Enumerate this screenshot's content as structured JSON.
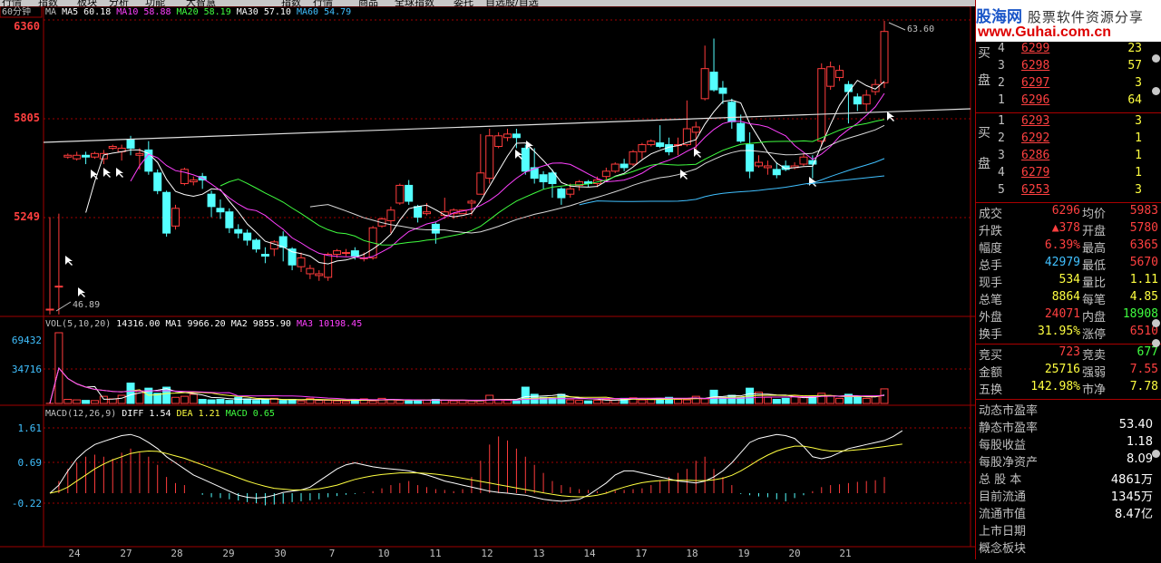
{
  "menubar": {
    "items": [
      "行情",
      "指数",
      "板块",
      "分析",
      "功能",
      "大智慧",
      "指数",
      "行情",
      "商品",
      "全球指数",
      "委托",
      "自选股/自选"
    ]
  },
  "chart_header": {
    "period": "60分钟",
    "ma_label": "MA",
    "ma": [
      {
        "name": "MA5",
        "value": "60.18",
        "color": "#ffffff"
      },
      {
        "name": "MA10",
        "value": "58.88",
        "color": "#ff40ff"
      },
      {
        "name": "MA20",
        "value": "58.19",
        "color": "#40ff40"
      },
      {
        "name": "MA30",
        "value": "57.10",
        "color": "#ffffff"
      },
      {
        "name": "MA60",
        "value": "54.79",
        "color": "#40c0ff"
      }
    ]
  },
  "price_axis": {
    "labels": [
      "6360",
      "5805",
      "5249"
    ],
    "high_mark": "63.60",
    "low_mark": "46.89"
  },
  "vol_header": {
    "label": "VOL(5,10,20)",
    "vol": "14316.00",
    "ma1": "MA1 9966.20",
    "ma2": "MA2 9855.90",
    "ma3": "MA3 10198.45"
  },
  "vol_axis": {
    "labels": [
      "69432",
      "34716"
    ]
  },
  "macd_header": {
    "label": "MACD(12,26,9)",
    "diff": "DIFF 1.54",
    "dea": "DEA 1.21",
    "macd": "MACD 0.65"
  },
  "macd_axis": {
    "labels": [
      "1.61",
      "0.69",
      "-0.22"
    ]
  },
  "date_axis": {
    "labels": [
      "24",
      "27",
      "28",
      "29",
      "30",
      "7",
      "10",
      "11",
      "12",
      "13",
      "14",
      "17",
      "18",
      "19",
      "20",
      "21"
    ]
  },
  "chart_data": {
    "type": "candlestick",
    "price_range": [
      46.89,
      63.6
    ],
    "vol_range": [
      0,
      69432
    ],
    "macd_range": [
      -0.22,
      1.61
    ],
    "candles": [
      [
        47.3,
        47.3,
        52.5,
        47.0,
        60
      ],
      [
        48.6,
        48.6,
        52.7,
        47.0,
        69432
      ],
      [
        55.9,
        56.0,
        56.1,
        55.8,
        4000
      ],
      [
        55.8,
        56.0,
        56.2,
        55.7,
        3500
      ],
      [
        56.0,
        55.9,
        56.2,
        55.5,
        3000
      ],
      [
        55.9,
        56.1,
        56.2,
        55.8,
        2800
      ],
      [
        55.8,
        56.1,
        56.3,
        55.5,
        7000
      ],
      [
        56.4,
        56.5,
        56.6,
        56.3,
        4500
      ],
      [
        56.2,
        56.4,
        56.6,
        55.7,
        8000
      ],
      [
        56.9,
        56.4,
        57.1,
        56.0,
        20000
      ],
      [
        56.0,
        56.1,
        56.4,
        55.2,
        12000
      ],
      [
        56.3,
        55.1,
        56.8,
        54.9,
        15000
      ],
      [
        55.0,
        54.0,
        55.2,
        53.8,
        10000
      ],
      [
        53.9,
        51.6,
        54.0,
        51.4,
        16000
      ],
      [
        52.0,
        53.0,
        53.2,
        51.8,
        6000
      ],
      [
        54.4,
        55.2,
        55.3,
        54.3,
        7000
      ],
      [
        54.5,
        54.6,
        54.8,
        54.3,
        9000
      ],
      [
        54.8,
        54.6,
        55.0,
        54.1,
        4000
      ],
      [
        53.8,
        53.1,
        54.0,
        52.5,
        3500
      ],
      [
        53.0,
        52.8,
        53.5,
        52.4,
        4000
      ],
      [
        52.8,
        51.9,
        53.0,
        51.6,
        3000
      ],
      [
        51.8,
        51.6,
        52.1,
        51.3,
        6000
      ],
      [
        51.6,
        51.2,
        51.8,
        50.9,
        4500
      ],
      [
        51.2,
        50.7,
        51.3,
        50.5,
        3000
      ],
      [
        50.4,
        50.3,
        50.8,
        49.9,
        3500
      ],
      [
        50.7,
        51.1,
        51.2,
        50.3,
        5000
      ],
      [
        51.4,
        50.8,
        51.7,
        50.0,
        3000
      ],
      [
        50.7,
        49.8,
        50.8,
        49.5,
        4000
      ],
      [
        49.7,
        50.2,
        50.5,
        49.4,
        2500
      ],
      [
        49.3,
        49.6,
        49.8,
        49.0,
        5000
      ],
      [
        49.2,
        49.3,
        49.5,
        48.9,
        3000
      ],
      [
        49.1,
        50.4,
        50.5,
        48.9,
        3000
      ],
      [
        50.4,
        50.6,
        50.7,
        50.2,
        2500
      ],
      [
        50.5,
        50.5,
        50.7,
        50.3,
        2000
      ],
      [
        50.6,
        50.3,
        50.8,
        50.1,
        4000
      ],
      [
        50.2,
        50.2,
        50.5,
        50.0,
        4500
      ],
      [
        50.2,
        51.9,
        52.0,
        50.1,
        2500
      ],
      [
        52.0,
        52.4,
        52.5,
        51.9,
        5000
      ],
      [
        52.3,
        52.9,
        53.1,
        51.6,
        4000
      ],
      [
        53.3,
        54.3,
        54.4,
        53.2,
        3000
      ],
      [
        54.3,
        53.4,
        54.6,
        53.2,
        2500
      ],
      [
        53.1,
        52.5,
        53.2,
        52.2,
        2800
      ],
      [
        52.7,
        52.8,
        53.3,
        52.6,
        3200
      ],
      [
        52.1,
        51.6,
        52.2,
        51.0,
        4000
      ],
      [
        52.6,
        52.8,
        53.6,
        52.4,
        3000
      ],
      [
        52.7,
        52.9,
        53.0,
        52.4,
        2500
      ],
      [
        52.7,
        52.9,
        52.9,
        52.7,
        2800
      ],
      [
        53.3,
        53.4,
        53.5,
        52.6,
        2500
      ],
      [
        53.8,
        55.0,
        57.2,
        53.8,
        2500
      ],
      [
        54.7,
        57.1,
        57.5,
        54.4,
        8000
      ],
      [
        56.5,
        57.1,
        57.3,
        56.4,
        4000
      ],
      [
        57.0,
        57.2,
        57.5,
        56.8,
        3000
      ],
      [
        57.2,
        57.0,
        57.5,
        56.4,
        2500
      ],
      [
        56.4,
        55.1,
        56.6,
        54.9,
        16000
      ],
      [
        55.3,
        54.7,
        56.4,
        54.4,
        9000
      ],
      [
        54.9,
        54.5,
        55.1,
        54.1,
        6000
      ],
      [
        55.0,
        54.4,
        55.2,
        53.6,
        5000
      ],
      [
        54.1,
        53.6,
        54.2,
        53.2,
        9000
      ],
      [
        53.8,
        54.1,
        54.4,
        53.6,
        3500
      ],
      [
        54.3,
        54.5,
        54.6,
        54.0,
        3000
      ],
      [
        54.5,
        54.4,
        54.6,
        54.2,
        2500
      ],
      [
        54.4,
        54.6,
        54.8,
        54.2,
        3000
      ],
      [
        54.8,
        55.1,
        55.3,
        54.6,
        4000
      ],
      [
        55.1,
        55.5,
        55.6,
        55.0,
        3500
      ],
      [
        55.5,
        55.3,
        55.8,
        55.1,
        5000
      ],
      [
        55.5,
        56.2,
        56.3,
        55.4,
        5500
      ],
      [
        56.2,
        56.6,
        56.7,
        55.8,
        3500
      ],
      [
        56.6,
        56.8,
        56.9,
        56.5,
        4500
      ],
      [
        56.7,
        56.5,
        57.7,
        56.4,
        5000
      ],
      [
        56.6,
        56.2,
        57.0,
        56.0,
        6000
      ],
      [
        56.6,
        56.6,
        57.0,
        56.0,
        4000
      ],
      [
        56.6,
        57.5,
        59.1,
        56.5,
        3500
      ],
      [
        57.3,
        57.6,
        57.9,
        56.2,
        7000
      ],
      [
        59.2,
        60.9,
        62.2,
        59.1,
        4500
      ],
      [
        60.7,
        59.7,
        62.6,
        59.6,
        13000
      ],
      [
        59.8,
        59.5,
        60.2,
        58.9,
        6000
      ],
      [
        59.0,
        57.9,
        59.2,
        57.5,
        8000
      ],
      [
        57.8,
        56.8,
        58.3,
        56.7,
        6000
      ],
      [
        56.6,
        55.1,
        57.3,
        54.7,
        15000
      ],
      [
        55.4,
        55.6,
        56.0,
        55.3,
        11000
      ],
      [
        55.3,
        55.4,
        55.7,
        54.9,
        6000
      ],
      [
        55.2,
        54.9,
        55.6,
        54.7,
        4000
      ],
      [
        55.4,
        55.2,
        55.7,
        55.1,
        5000
      ],
      [
        55.3,
        55.4,
        55.6,
        55.2,
        7000
      ],
      [
        55.5,
        55.9,
        56.1,
        55.4,
        6500
      ],
      [
        55.7,
        55.5,
        56.0,
        54.7,
        7000
      ],
      [
        56.8,
        60.9,
        61.2,
        56.5,
        10000
      ],
      [
        59.9,
        61.0,
        61.3,
        59.7,
        7500
      ],
      [
        60.4,
        60.8,
        61.1,
        60.2,
        5000
      ],
      [
        60.0,
        59.6,
        60.2,
        57.8,
        9000
      ],
      [
        59.3,
        58.9,
        59.5,
        58.5,
        6500
      ],
      [
        58.9,
        59.4,
        59.7,
        58.5,
        5000
      ],
      [
        59.6,
        60.0,
        60.3,
        59.4,
        7000
      ],
      [
        60.1,
        63.0,
        63.6,
        59.8,
        14316
      ]
    ],
    "macd_hist": [
      0.0,
      0.3,
      0.6,
      0.75,
      0.9,
      0.95,
      0.9,
      0.85,
      1.0,
      1.1,
      1.0,
      0.9,
      0.7,
      0.4,
      0.25,
      0.2,
      0.0,
      -0.04,
      -0.1,
      -0.12,
      -0.15,
      -0.18,
      -0.22,
      -0.25,
      -0.3,
      -0.28,
      -0.26,
      -0.22,
      -0.2,
      -0.18,
      -0.15,
      -0.1,
      -0.07,
      -0.04,
      -0.02,
      0.02,
      0.05,
      0.12,
      0.2,
      0.25,
      0.3,
      0.2,
      0.15,
      0.1,
      0.08,
      0.05,
      0.1,
      0.4,
      0.8,
      1.2,
      1.4,
      1.3,
      1.1,
      0.9,
      0.7,
      0.5,
      0.3,
      0.2,
      0.15,
      0.1,
      0.08,
      0.05,
      0.04,
      0.06,
      0.08,
      0.1,
      0.12,
      0.2,
      0.3,
      0.4,
      0.5,
      0.6,
      0.8,
      0.9,
      0.6,
      0.4,
      0.2,
      -0.02,
      -0.05,
      -0.08,
      -0.1,
      -0.15,
      -0.2,
      -0.12,
      -0.05,
      0.05,
      0.15,
      0.2,
      0.22,
      0.25,
      0.28,
      0.3,
      0.32,
      0.4,
      0.6,
      0.65
    ],
    "diff_line": [
      0.0,
      0.2,
      0.55,
      0.85,
      1.05,
      1.2,
      1.28,
      1.35,
      1.42,
      1.45,
      1.38,
      1.25,
      1.1,
      0.9,
      0.75,
      0.6,
      0.45,
      0.35,
      0.25,
      0.15,
      0.05,
      -0.05,
      -0.1,
      -0.12,
      -0.1,
      -0.05,
      0.02,
      0.05,
      0.08,
      0.15,
      0.3,
      0.45,
      0.6,
      0.7,
      0.75,
      0.7,
      0.65,
      0.62,
      0.6,
      0.58,
      0.55,
      0.5,
      0.45,
      0.38,
      0.3,
      0.25,
      0.2,
      0.15,
      0.1,
      0.05,
      0.02,
      0.0,
      -0.03,
      -0.05,
      -0.1,
      -0.15,
      -0.18,
      -0.2,
      -0.18,
      -0.15,
      -0.05,
      0.1,
      0.25,
      0.45,
      0.55,
      0.55,
      0.5,
      0.45,
      0.4,
      0.35,
      0.3,
      0.28,
      0.25,
      0.3,
      0.4,
      0.55,
      0.75,
      1.0,
      1.25,
      1.35,
      1.4,
      1.45,
      1.42,
      1.35,
      1.15,
      0.9,
      0.85,
      0.9,
      1.0,
      1.1,
      1.15,
      1.2,
      1.25,
      1.3,
      1.4,
      1.54
    ],
    "dea_line": [
      0.0,
      0.05,
      0.15,
      0.3,
      0.45,
      0.6,
      0.72,
      0.82,
      0.9,
      0.98,
      1.02,
      1.04,
      1.03,
      0.98,
      0.92,
      0.86,
      0.78,
      0.7,
      0.62,
      0.54,
      0.46,
      0.38,
      0.3,
      0.23,
      0.17,
      0.12,
      0.1,
      0.08,
      0.08,
      0.09,
      0.11,
      0.15,
      0.2,
      0.27,
      0.34,
      0.39,
      0.43,
      0.46,
      0.48,
      0.5,
      0.5,
      0.5,
      0.49,
      0.47,
      0.44,
      0.41,
      0.37,
      0.33,
      0.29,
      0.25,
      0.21,
      0.17,
      0.13,
      0.09,
      0.05,
      0.01,
      -0.03,
      -0.06,
      -0.08,
      -0.09,
      -0.08,
      -0.05,
      0.0,
      0.08,
      0.15,
      0.21,
      0.26,
      0.29,
      0.31,
      0.32,
      0.32,
      0.32,
      0.31,
      0.31,
      0.33,
      0.37,
      0.44,
      0.55,
      0.68,
      0.82,
      0.94,
      1.04,
      1.11,
      1.16,
      1.16,
      1.12,
      1.07,
      1.04,
      1.04,
      1.05,
      1.07,
      1.09,
      1.12,
      1.15,
      1.18,
      1.21
    ]
  },
  "quote_panel": {
    "logo_cn": "股海网",
    "logo_sub": "股票软件资源分享",
    "logo_url": "www.Guhai.com.cn",
    "sell_label_1": "买",
    "sell_label_2": "盘",
    "buy_label_1": "买",
    "buy_label_2": "盘",
    "sells": [
      {
        "n": "4",
        "price": "6299",
        "vol": "23"
      },
      {
        "n": "3",
        "price": "6298",
        "vol": "57"
      },
      {
        "n": "2",
        "price": "6297",
        "vol": "3"
      },
      {
        "n": "1",
        "price": "6296",
        "vol": "64"
      }
    ],
    "buys": [
      {
        "n": "1",
        "price": "6293",
        "vol": "3"
      },
      {
        "n": "2",
        "price": "6292",
        "vol": "1"
      },
      {
        "n": "3",
        "price": "6286",
        "vol": "1"
      },
      {
        "n": "4",
        "price": "6279",
        "vol": "1"
      },
      {
        "n": "5",
        "price": "6253",
        "vol": "3"
      }
    ],
    "stats": [
      {
        "l": "成交",
        "v": "6296",
        "l2": "均价",
        "v2": "5983",
        "vc": "#ff4040",
        "v2c": "#ff4040"
      },
      {
        "l": "升跌",
        "v": "▲378",
        "l2": "开盘",
        "v2": "5780",
        "vc": "#ff4040",
        "v2c": "#ff4040"
      },
      {
        "l": "幅度",
        "v": "6.39%",
        "l2": "最高",
        "v2": "6365",
        "vc": "#ff4040",
        "v2c": "#ff4040"
      },
      {
        "l": "总手",
        "v": "42979",
        "l2": "最低",
        "v2": "5670",
        "vc": "#40c0ff",
        "v2c": "#ff4040"
      },
      {
        "l": "现手",
        "v": "534",
        "l2": "量比",
        "v2": "1.11",
        "vc": "#ffff40",
        "v2c": "#ffff40"
      },
      {
        "l": "总笔",
        "v": "8864",
        "l2": "每笔",
        "v2": "4.85",
        "vc": "#ffff40",
        "v2c": "#ffff40"
      },
      {
        "l": "外盘",
        "v": "24071",
        "l2": "内盘",
        "v2": "18908",
        "vc": "#ff4040",
        "v2c": "#40ff40"
      },
      {
        "l": "换手",
        "v": "31.95%",
        "l2": "涨停",
        "v2": "6510",
        "vc": "#ffff40",
        "v2c": "#ff4040"
      }
    ],
    "auction": [
      {
        "l": "竞买",
        "v": "723",
        "l2": "竞卖",
        "v2": "677",
        "vc": "#ff4040",
        "v2c": "#40ff40"
      },
      {
        "l": "金额",
        "v": "25716",
        "l2": "强弱",
        "v2": "7.55",
        "vc": "#ffff40",
        "v2c": "#ff4040"
      },
      {
        "l": "五换",
        "v": "142.98%",
        "l2": "市净",
        "v2": "7.78",
        "vc": "#ffff40",
        "v2c": "#ffff40"
      }
    ],
    "fund": [
      {
        "l": "动态市盈率",
        "v": ""
      },
      {
        "l": "静态市盈率",
        "v": "53.40"
      },
      {
        "l": "每股收益",
        "v": "1.18"
      },
      {
        "l": "每股净资产",
        "v": "8.09"
      },
      {
        "l": "总 股 本",
        "v": "4861万"
      },
      {
        "l": "目前流通",
        "v": "1345万"
      },
      {
        "l": "流通市值",
        "v": "8.47亿"
      },
      {
        "l": "上市日期",
        "v": ""
      },
      {
        "l": "概念板块",
        "v": ""
      }
    ]
  },
  "colors": {
    "up": "#ff3c3c",
    "down": "#54ffff",
    "grid": "#a00000"
  }
}
